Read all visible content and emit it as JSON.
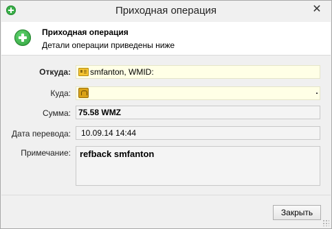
{
  "window": {
    "title": "Приходная операция",
    "close_glyph": "✕"
  },
  "header": {
    "title": "Приходная операция",
    "subtitle": "Детали операции приведены ниже",
    "icon": "add-green-icon"
  },
  "form": {
    "from_label": "Откуда:",
    "from_value": "smfanton, WMID:",
    "to_label": "Куда:",
    "to_value": "",
    "amount_label": "Сумма:",
    "amount_value": "75.58 WMZ",
    "date_label": "Дата перевода:",
    "date_value": "10.09.14 14:44",
    "note_label": "Примечание:",
    "note_value": "refback smfanton"
  },
  "footer": {
    "close_label": "Закрыть"
  },
  "colors": {
    "highlight_field": "#ffffe6",
    "readonly_field": "#f4f4f4",
    "accent_green": "#3bb14a"
  }
}
